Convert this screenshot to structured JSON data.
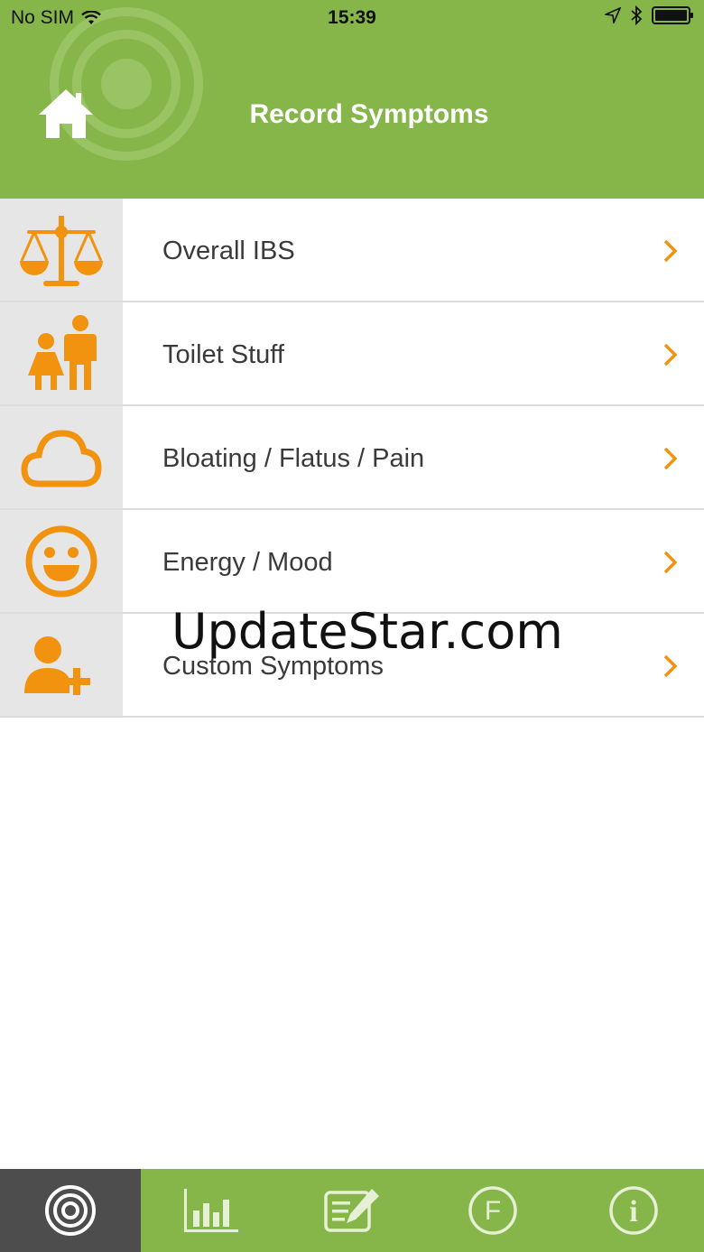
{
  "status_bar": {
    "carrier": "No SIM",
    "time": "15:39"
  },
  "header": {
    "title": "Record Symptoms",
    "home_icon": "home-icon",
    "background_color": "#86b64a"
  },
  "list": {
    "accent_color": "#f2930f",
    "items": [
      {
        "label": "Overall IBS",
        "icon": "scales-icon"
      },
      {
        "label": "Toilet Stuff",
        "icon": "people-icon"
      },
      {
        "label": "Bloating / Flatus / Pain",
        "icon": "cloud-icon"
      },
      {
        "label": "Energy / Mood",
        "icon": "smiley-icon"
      },
      {
        "label": "Custom Symptoms",
        "icon": "add-person-icon"
      }
    ]
  },
  "watermark": {
    "text": "UpdateStar.com"
  },
  "tabbar": {
    "tabs": [
      {
        "icon": "target-icon",
        "active": true
      },
      {
        "icon": "bar-chart-icon",
        "active": false
      },
      {
        "icon": "edit-notes-icon",
        "active": false
      },
      {
        "icon": "f-circle-icon",
        "active": false,
        "glyph": "F"
      },
      {
        "icon": "info-icon",
        "active": false,
        "glyph": "i"
      }
    ]
  }
}
